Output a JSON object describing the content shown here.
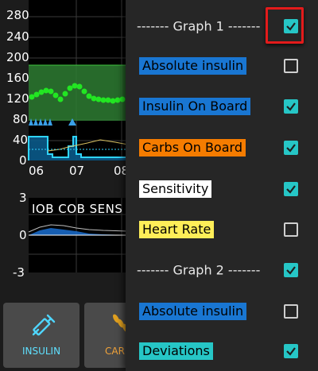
{
  "graph1": {
    "y_ticks": [
      "280",
      "240",
      "200",
      "160",
      "120",
      "80",
      "40",
      "0"
    ],
    "x_ticks": [
      "06",
      "07",
      "08"
    ]
  },
  "graph2": {
    "label": "IOB COB SENS",
    "y_ticks": [
      "3",
      "0",
      "-3"
    ]
  },
  "nav": {
    "insulin_label": "INSULIN",
    "carbs_label": "CAR"
  },
  "menu": {
    "items": [
      {
        "label": "------- Graph 1 -------",
        "header": true,
        "checked": true,
        "bg": ""
      },
      {
        "label": "Absolute insulin",
        "header": false,
        "checked": false,
        "bg": "#1976d2"
      },
      {
        "label": "Insulin On Board",
        "header": false,
        "checked": true,
        "bg": "#1976d2"
      },
      {
        "label": "Carbs On Board",
        "header": false,
        "checked": true,
        "bg": "#f57c00"
      },
      {
        "label": "Sensitivity",
        "header": false,
        "checked": true,
        "bg": "#ffffff"
      },
      {
        "label": "Heart Rate",
        "header": false,
        "checked": false,
        "bg": "#ffee58"
      },
      {
        "label": "------- Graph 2 -------",
        "header": true,
        "checked": true,
        "bg": ""
      },
      {
        "label": "Absolute insulin",
        "header": false,
        "checked": false,
        "bg": "#1976d2"
      },
      {
        "label": "Deviations",
        "header": false,
        "checked": true,
        "bg": "#26c6c6"
      }
    ]
  },
  "colors": {
    "accent": "#26c6c6",
    "in_range": "#2e7d32",
    "bg_points": "#22e622",
    "highlight": "#e31b1b"
  }
}
